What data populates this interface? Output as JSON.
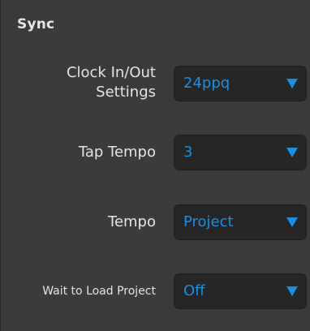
{
  "section": {
    "title": "Sync"
  },
  "rows": [
    {
      "label_line1": "Clock In/Out",
      "label_line2": "Settings",
      "value": "24ppq"
    },
    {
      "label": "Tap Tempo",
      "value": "3"
    },
    {
      "label": "Tempo",
      "value": "Project"
    },
    {
      "label": "Wait to Load Project",
      "value": "Off"
    }
  ],
  "colors": {
    "background": "#3b3b3b",
    "dropdown_bg": "#262626",
    "accent": "#1a8fe3",
    "label_text": "#e4e4e4"
  },
  "icons": {
    "dropdown_arrow": "triangle-down-icon"
  }
}
